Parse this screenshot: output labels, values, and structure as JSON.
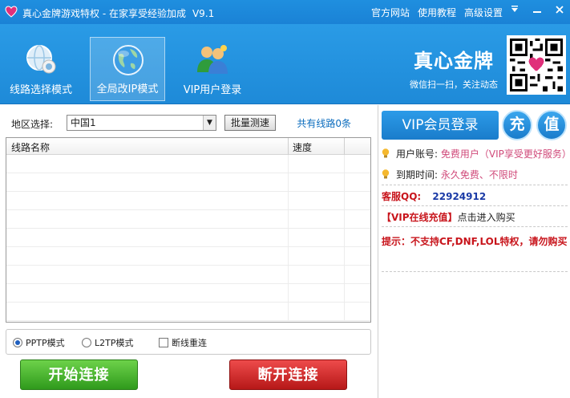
{
  "titlebar": {
    "title": "真心金牌游戏特权 - 在家享受经验加成",
    "version": "V9.1",
    "links": [
      "官方网站",
      "使用教程",
      "高级设置"
    ]
  },
  "header": {
    "tabs": [
      {
        "label": "线路选择模式",
        "icon": "net-globe-icon",
        "active": false
      },
      {
        "label": "全局改IP模式",
        "icon": "globe-icon",
        "active": true
      },
      {
        "label": "VIP用户登录",
        "icon": "users-icon",
        "active": false
      }
    ],
    "brand_title": "真心金牌",
    "brand_sub": "微信扫一扫，关注动态"
  },
  "region": {
    "label": "地区选择:",
    "selected": "中国1",
    "test_button": "批量测速",
    "line_count": "共有线路0条"
  },
  "table": {
    "columns": [
      "线路名称",
      "速度"
    ],
    "rows": []
  },
  "options": {
    "pptp": "PPTP模式",
    "l2tp": "L2TP模式",
    "reconnect": "断线重连",
    "selected": "pptp"
  },
  "buttons": {
    "start": "开始连接",
    "stop": "断开连接"
  },
  "right": {
    "vip_login": "VIP会员登录",
    "recharge": "充",
    "value": "值",
    "account_label": "用户账号:",
    "account_value": "免费用户（VIP享受更好服务）",
    "expiry_label": "到期时间:",
    "expiry_value": "永久免费、不限时",
    "qq_label": "客服QQ:",
    "qq_value": "22924912",
    "recharge_link": "【VIP在线充值】",
    "recharge_suffix": "点击进入购买",
    "tip": "提示：不支持CF,DNF,LOL特权，请勿购买"
  },
  "colors": {
    "header_blue": "#1e8ad8",
    "start_green": "#3aa82a",
    "stop_red": "#c81d1d",
    "notice_red": "#c8151c"
  }
}
